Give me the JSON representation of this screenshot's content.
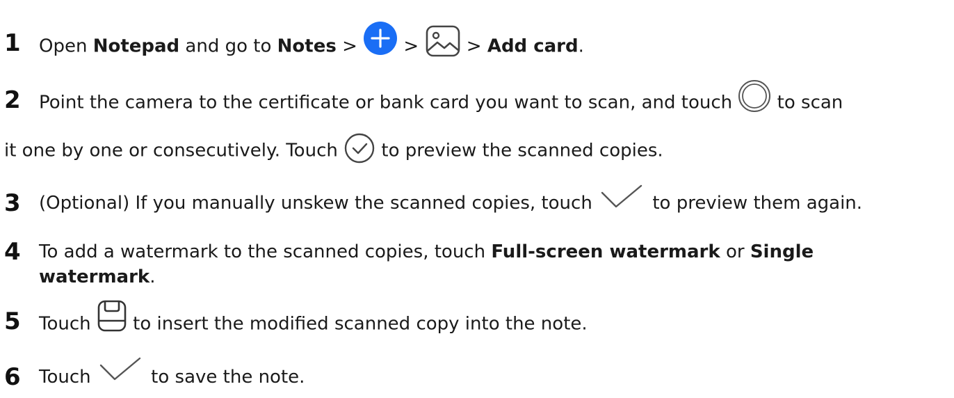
{
  "steps": [
    {
      "number": "1",
      "t1": "Open ",
      "b1": "Notepad",
      "t2": " and go to ",
      "b2": "Notes",
      "t3": " > ",
      "icon1": "add-circle-icon",
      "t4": " > ",
      "icon2": "image-icon",
      "t5": " > ",
      "b3": "Add card",
      "t6": "."
    },
    {
      "number": "2",
      "t1": "Point the camera to the certificate or bank card you want to scan, and touch ",
      "icon1": "shutter-icon",
      "t2": " to scan",
      "t3": "it one by one or consecutively. Touch ",
      "icon2": "check-circle-icon",
      "t4": " to preview the scanned copies."
    },
    {
      "number": "3",
      "t1": "(Optional) If you manually unskew the scanned copies, touch ",
      "icon1": "check-icon",
      "t2": " to preview them again."
    },
    {
      "number": "4",
      "t1": "To add a watermark to the scanned copies, touch ",
      "b1": "Full-screen watermark",
      "t2": " or ",
      "b2": "Single",
      "b3": "watermark",
      "t3": "."
    },
    {
      "number": "5",
      "t1": "Touch ",
      "icon1": "save-icon",
      "t2": " to insert the modified scanned copy into the note."
    },
    {
      "number": "6",
      "t1": "Touch ",
      "icon1": "check-icon",
      "t2": " to save the note."
    }
  ],
  "colors": {
    "accent": "#1a6ef5",
    "text": "#1a1a1a",
    "icon": "#444444"
  }
}
